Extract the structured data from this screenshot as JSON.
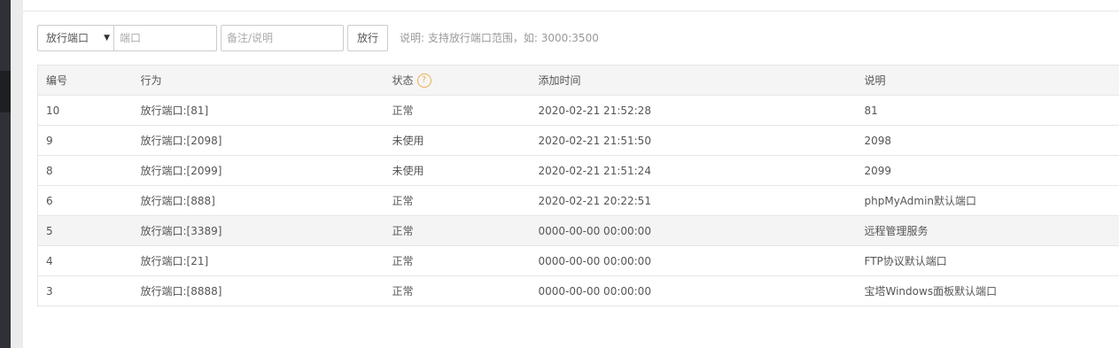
{
  "toolbar": {
    "action_select": "放行端口",
    "port_placeholder": "端口",
    "note_placeholder": "备注/说明",
    "submit_label": "放行",
    "hint": "说明: 支持放行端口范围，如: 3000:3500"
  },
  "table": {
    "headers": [
      "编号",
      "行为",
      "状态",
      "添加时间",
      "说明"
    ],
    "help_glyph": "?",
    "rows": [
      {
        "id": "10",
        "action": "放行端口:[81]",
        "status": "正常",
        "time": "2020-02-21 21:52:28",
        "note": "81"
      },
      {
        "id": "9",
        "action": "放行端口:[2098]",
        "status": "未使用",
        "time": "2020-02-21 21:51:50",
        "note": "2098"
      },
      {
        "id": "8",
        "action": "放行端口:[2099]",
        "status": "未使用",
        "time": "2020-02-21 21:51:24",
        "note": "2099"
      },
      {
        "id": "6",
        "action": "放行端口:[888]",
        "status": "正常",
        "time": "2020-02-21 20:22:51",
        "note": "phpMyAdmin默认端口"
      },
      {
        "id": "5",
        "action": "放行端口:[3389]",
        "status": "正常",
        "time": "0000-00-00 00:00:00",
        "note": "远程管理服务"
      },
      {
        "id": "4",
        "action": "放行端口:[21]",
        "status": "正常",
        "time": "0000-00-00 00:00:00",
        "note": "FTP协议默认端口"
      },
      {
        "id": "3",
        "action": "放行端口:[8888]",
        "status": "正常",
        "time": "0000-00-00 00:00:00",
        "note": "宝塔Windows面板默认端口"
      }
    ]
  }
}
